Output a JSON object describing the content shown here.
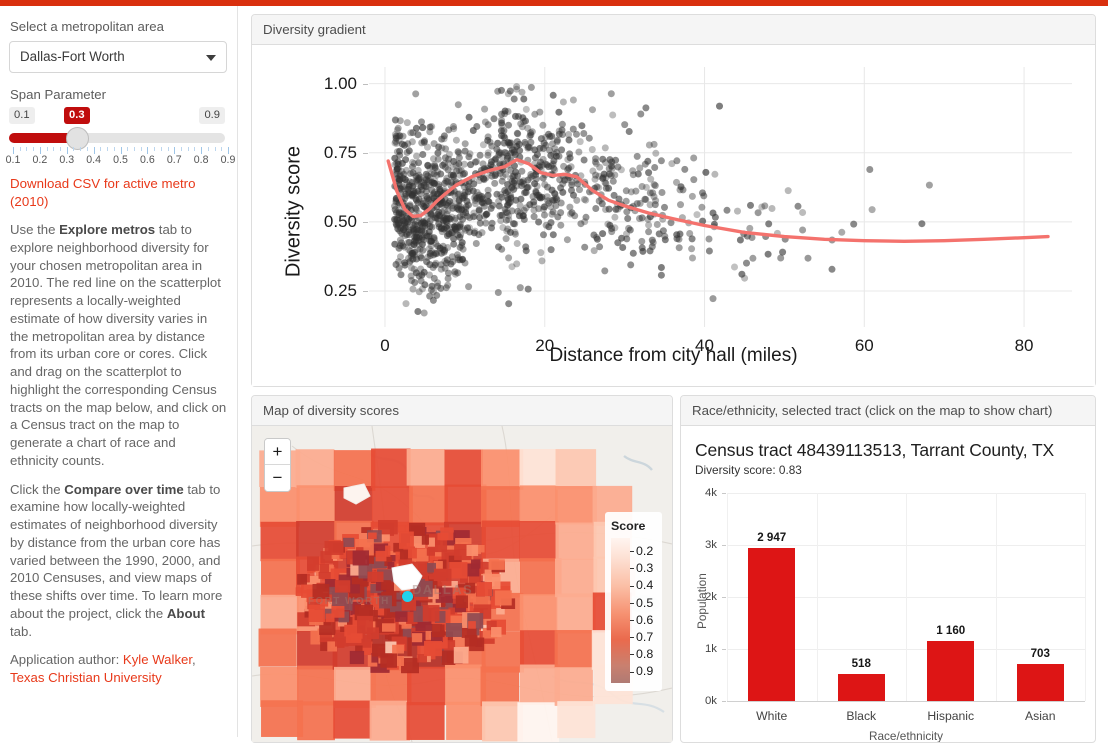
{
  "theme": {
    "accent": "#d9300e",
    "link": "#e8391a",
    "bar_red": "#dd1515",
    "slider_red": "#c00d0d",
    "loess_line": "#f4726d"
  },
  "sidebar": {
    "metro_label": "Select a metropolitan area",
    "metro_value": "Dallas-Fort Worth",
    "span_label": "Span Parameter",
    "slider": {
      "min_label": "0.1",
      "max_label": "0.9",
      "current_label": "0.3",
      "ticks": [
        "0.1",
        "0.2",
        "0.3",
        "0.4",
        "0.5",
        "0.6",
        "0.7",
        "0.8",
        "0.9"
      ]
    },
    "download_link": "Download CSV for active metro (2010)",
    "paragraph1_a": "Use the ",
    "paragraph1_b": "Explore metros",
    "paragraph1_c": " tab to explore neighborhood diversity for your chosen metropolitan area in 2010. The red line on the scatterplot represents a locally-weighted estimate of how diversity varies in the metropolitan area by distance from its urban core or cores. Click and drag on the scatterplot to highlight the corresponding Census tracts on the map below, and click on a Census tract on the map to generate a chart of race and ethnicity counts.",
    "paragraph2_a": "Click the ",
    "paragraph2_b": "Compare over time",
    "paragraph2_c": " tab to examine how locally-weighted estimates of neighborhood diversity by distance from the urban core has varied between the 1990, 2000, and 2010 Censuses, and view maps of these shifts over time. To learn more about the project, click the ",
    "paragraph2_d": "About",
    "paragraph2_e": " tab.",
    "author_prefix": "Application author: ",
    "author_name": "Kyle Walker",
    "author_comma": ",",
    "author_org": "Texas Christian University"
  },
  "panels": {
    "gradient_title": "Diversity gradient",
    "map_title": "Map of diversity scores",
    "race_title": "Race/ethnicity, selected tract (click on the map to show chart)"
  },
  "map": {
    "zoom_in": "+",
    "zoom_out": "−",
    "legend_title": "Score",
    "legend_ticks": [
      "0.2",
      "0.3",
      "0.4",
      "0.5",
      "0.6",
      "0.7",
      "0.8",
      "0.9"
    ]
  },
  "race_panel": {
    "tract_title": "Census tract 48439113513, Tarrant County, TX",
    "diversity_score": "Diversity score: 0.83"
  },
  "chart_data": [
    {
      "type": "scatter",
      "title": "Diversity gradient",
      "xlabel": "Distance from city hall (miles)",
      "ylabel": "Diversity score",
      "xlim": [
        -2,
        86
      ],
      "ylim": [
        0.12,
        1.06
      ],
      "xticks": [
        0,
        20,
        40,
        60,
        80
      ],
      "yticks": [
        0.25,
        0.5,
        0.75,
        1.0
      ],
      "ytick_labels": [
        "0.25",
        "0.50",
        "0.75",
        "1.00"
      ],
      "xtick_labels": [
        "0",
        "20",
        "40",
        "60",
        "80"
      ],
      "grid": true,
      "point_color": "#333333",
      "point_opacity": 0.45,
      "n_points": 1250,
      "loess": {
        "name": "locally-weighted estimate",
        "color": "#f4726d",
        "x": [
          0.4,
          1.5,
          2.5,
          3.5,
          4.5,
          5.5,
          6.5,
          7.5,
          9,
          11,
          13,
          15,
          16.5,
          18,
          19.5,
          21,
          22.5,
          24,
          26,
          28,
          30,
          33,
          36,
          40,
          45,
          50,
          55,
          60,
          65,
          70,
          75,
          80,
          83
        ],
        "y": [
          0.72,
          0.61,
          0.545,
          0.52,
          0.523,
          0.545,
          0.575,
          0.6,
          0.635,
          0.665,
          0.685,
          0.7,
          0.725,
          0.71,
          0.678,
          0.668,
          0.672,
          0.663,
          0.613,
          0.578,
          0.558,
          0.532,
          0.512,
          0.487,
          0.462,
          0.447,
          0.437,
          0.432,
          0.43,
          0.432,
          0.437,
          0.443,
          0.447
        ]
      }
    },
    {
      "type": "bar",
      "title": "Census tract 48439113513, Tarrant County, TX",
      "subtitle": "Diversity score: 0.83",
      "xlabel": "Race/ethnicity",
      "ylabel": "Population",
      "categories": [
        "White",
        "Black",
        "Hispanic",
        "Asian"
      ],
      "values": [
        2947,
        518,
        1160,
        703
      ],
      "value_labels": [
        "2 947",
        "518",
        "1 160",
        "703"
      ],
      "ylim": [
        0,
        4000
      ],
      "yticks": [
        0,
        1000,
        2000,
        3000,
        4000
      ],
      "ytick_labels": [
        "0k",
        "1k",
        "2k",
        "3k",
        "4k"
      ],
      "bar_color": "#dd1515",
      "grid": true
    }
  ]
}
